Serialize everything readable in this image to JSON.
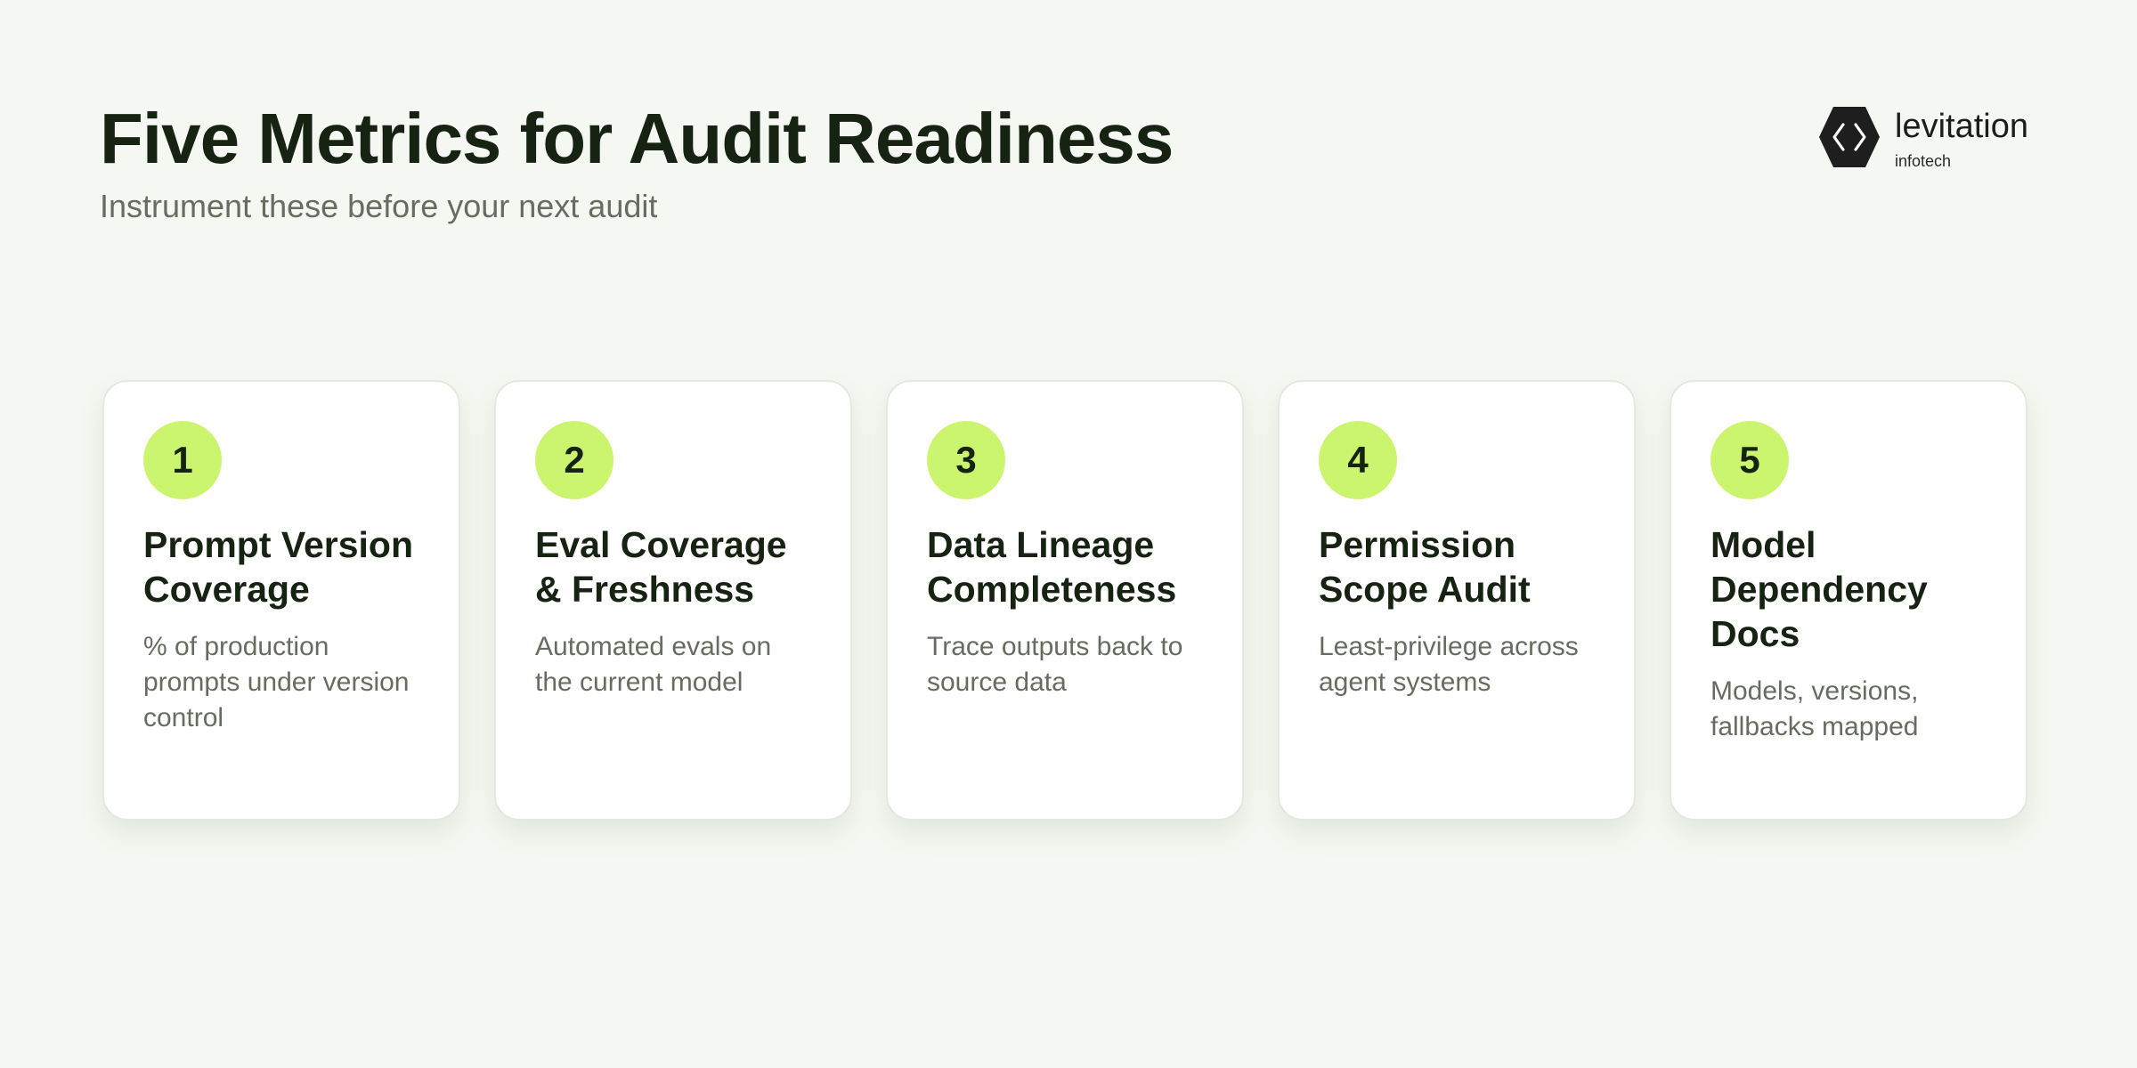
{
  "header": {
    "title": "Five Metrics for Audit Readiness",
    "subtitle": "Instrument these before your next audit"
  },
  "logo": {
    "name": "levitation",
    "sub": "infotech",
    "icon": "hexagon-chevrons-icon"
  },
  "colors": {
    "background": "#f5f8f2",
    "accent": "#cbf56f",
    "title": "#172312",
    "muted": "#666d60"
  },
  "cards": [
    {
      "number": "1",
      "title": "Prompt Version Coverage",
      "description": "% of production prompts under version control"
    },
    {
      "number": "2",
      "title": "Eval Coverage & Freshness",
      "description": "Automated evals on the current model"
    },
    {
      "number": "3",
      "title": "Data Lineage Completeness",
      "description": "Trace outputs back to source data"
    },
    {
      "number": "4",
      "title": "Permission Scope Audit",
      "description": "Least-privilege across agent systems"
    },
    {
      "number": "5",
      "title": "Model Dependency Docs",
      "description": "Models, versions, fallbacks mapped"
    }
  ]
}
